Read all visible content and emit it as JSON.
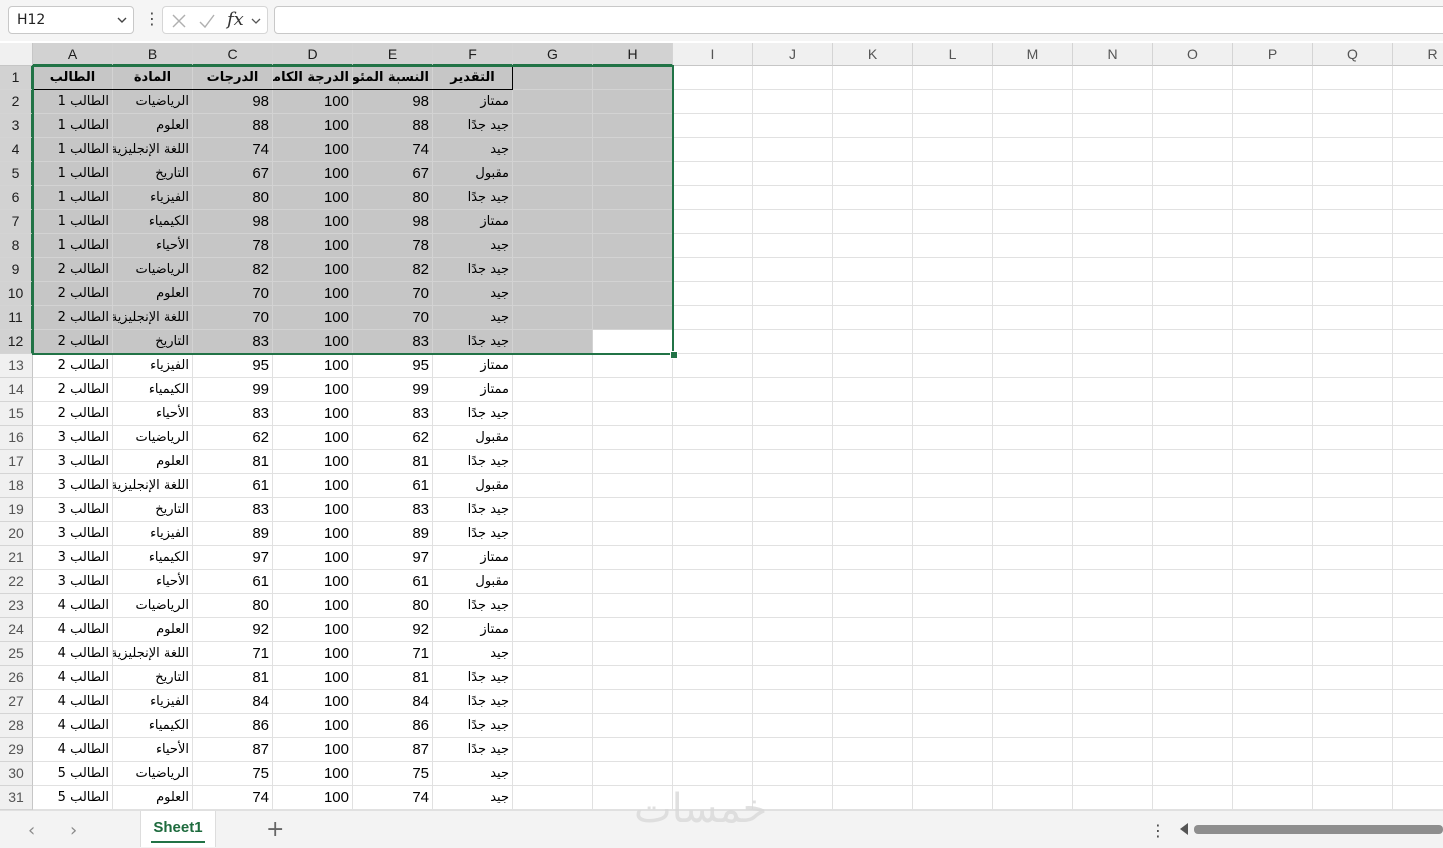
{
  "formula_bar": {
    "name_box": "H12",
    "fx_label": "fx",
    "formula": ""
  },
  "columns": [
    "A",
    "B",
    "C",
    "D",
    "E",
    "F",
    "G",
    "H",
    "I",
    "J",
    "K",
    "L",
    "M",
    "N",
    "O",
    "P",
    "Q",
    "R"
  ],
  "headers": [
    "الطالب",
    "المادة",
    "الدرجات",
    "الدرجة الكاملة",
    "النسبة المئوية",
    "التقدير"
  ],
  "rows": [
    [
      "الطالب 1",
      "الرياضيات",
      "98",
      "100",
      "98",
      "ممتاز"
    ],
    [
      "الطالب 1",
      "العلوم",
      "88",
      "100",
      "88",
      "جيد جدًا"
    ],
    [
      "الطالب 1",
      "اللغة الإنجليزية",
      "74",
      "100",
      "74",
      "جيد"
    ],
    [
      "الطالب 1",
      "التاريخ",
      "67",
      "100",
      "67",
      "مقبول"
    ],
    [
      "الطالب 1",
      "الفيزياء",
      "80",
      "100",
      "80",
      "جيد جدًا"
    ],
    [
      "الطالب 1",
      "الكيمياء",
      "98",
      "100",
      "98",
      "ممتاز"
    ],
    [
      "الطالب 1",
      "الأحياء",
      "78",
      "100",
      "78",
      "جيد"
    ],
    [
      "الطالب 2",
      "الرياضيات",
      "82",
      "100",
      "82",
      "جيد جدًا"
    ],
    [
      "الطالب 2",
      "العلوم",
      "70",
      "100",
      "70",
      "جيد"
    ],
    [
      "الطالب 2",
      "اللغة الإنجليزية",
      "70",
      "100",
      "70",
      "جيد"
    ],
    [
      "الطالب 2",
      "التاريخ",
      "83",
      "100",
      "83",
      "جيد جدًا"
    ],
    [
      "الطالب 2",
      "الفيزياء",
      "95",
      "100",
      "95",
      "ممتاز"
    ],
    [
      "الطالب 2",
      "الكيمياء",
      "99",
      "100",
      "99",
      "ممتاز"
    ],
    [
      "الطالب 2",
      "الأحياء",
      "83",
      "100",
      "83",
      "جيد جدًا"
    ],
    [
      "الطالب 3",
      "الرياضيات",
      "62",
      "100",
      "62",
      "مقبول"
    ],
    [
      "الطالب 3",
      "العلوم",
      "81",
      "100",
      "81",
      "جيد جدًا"
    ],
    [
      "الطالب 3",
      "اللغة الإنجليزية",
      "61",
      "100",
      "61",
      "مقبول"
    ],
    [
      "الطالب 3",
      "التاريخ",
      "83",
      "100",
      "83",
      "جيد جدًا"
    ],
    [
      "الطالب 3",
      "الفيزياء",
      "89",
      "100",
      "89",
      "جيد جدًا"
    ],
    [
      "الطالب 3",
      "الكيمياء",
      "97",
      "100",
      "97",
      "ممتاز"
    ],
    [
      "الطالب 3",
      "الأحياء",
      "61",
      "100",
      "61",
      "مقبول"
    ],
    [
      "الطالب 4",
      "الرياضيات",
      "80",
      "100",
      "80",
      "جيد جدًا"
    ],
    [
      "الطالب 4",
      "العلوم",
      "92",
      "100",
      "92",
      "ممتاز"
    ],
    [
      "الطالب 4",
      "اللغة الإنجليزية",
      "71",
      "100",
      "71",
      "جيد"
    ],
    [
      "الطالب 4",
      "التاريخ",
      "81",
      "100",
      "81",
      "جيد جدًا"
    ],
    [
      "الطالب 4",
      "الفيزياء",
      "84",
      "100",
      "84",
      "جيد جدًا"
    ],
    [
      "الطالب 4",
      "الكيمياء",
      "86",
      "100",
      "86",
      "جيد جدًا"
    ],
    [
      "الطالب 4",
      "الأحياء",
      "87",
      "100",
      "87",
      "جيد جدًا"
    ],
    [
      "الطالب 5",
      "الرياضيات",
      "75",
      "100",
      "75",
      "جيد"
    ],
    [
      "الطالب 5",
      "العلوم",
      "74",
      "100",
      "74",
      "جيد"
    ]
  ],
  "sheet_tabs": [
    "Sheet1"
  ],
  "watermark": "خمسات",
  "colors": {
    "selection_border": "#217346",
    "selection_fill": "#c6c6c6"
  }
}
